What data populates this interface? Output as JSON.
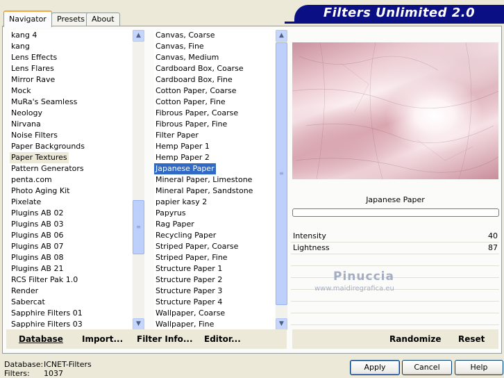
{
  "tabs": [
    "Navigator",
    "Presets",
    "About"
  ],
  "banner": "Filters Unlimited 2.0",
  "categories": {
    "items": [
      "kang 4",
      "kang",
      "Lens Effects",
      "Lens Flares",
      "Mirror Rave",
      "Mock",
      "MuRa's Seamless",
      "Neology",
      "Nirvana",
      "Noise Filters",
      "Paper Backgrounds",
      "Paper Textures",
      "Pattern Generators",
      "penta.com",
      "Photo Aging Kit",
      "Pixelate",
      "Plugins AB 02",
      "Plugins AB 03",
      "Plugins AB 06",
      "Plugins AB 07",
      "Plugins AB 08",
      "Plugins AB 21",
      "RCS Filter Pak 1.0",
      "Render",
      "Sabercat",
      "Sapphire Filters 01",
      "Sapphire Filters 03"
    ],
    "highlighted": "Paper Textures"
  },
  "filters": {
    "items": [
      "Canvas, Coarse",
      "Canvas, Fine",
      "Canvas, Medium",
      "Cardboard Box, Coarse",
      "Cardboard Box, Fine",
      "Cotton Paper, Coarse",
      "Cotton Paper, Fine",
      "Fibrous Paper, Coarse",
      "Fibrous Paper, Fine",
      "Filter Paper",
      "Hemp Paper 1",
      "Hemp Paper 2",
      "Japanese Paper",
      "Mineral Paper, Limestone",
      "Mineral Paper, Sandstone",
      "papier kasy 2",
      "Papyrus",
      "Rag Paper",
      "Recycling Paper",
      "Striped Paper, Coarse",
      "Striped Paper, Fine",
      "Structure Paper 1",
      "Structure Paper 2",
      "Structure Paper 3",
      "Structure Paper 4",
      "Wallpaper, Coarse",
      "Wallpaper, Fine"
    ],
    "selected": "Japanese Paper"
  },
  "preview": {
    "filter_name": "Japanese Paper",
    "watermark_name": "Pinuccia",
    "watermark_url": "www.maidiregrafica.eu"
  },
  "controls": [
    {
      "label": "Intensity",
      "value": "40"
    },
    {
      "label": "Lightness",
      "value": "87"
    }
  ],
  "bottom_buttons": {
    "database": "Database",
    "import": "Import...",
    "filter_info": "Filter Info...",
    "editor": "Editor...",
    "randomize": "Randomize",
    "reset": "Reset"
  },
  "status": {
    "database_label": "Database:",
    "database_value": "ICNET-Filters",
    "filters_label": "Filters:",
    "filters_value": "1037"
  },
  "dialog_buttons": {
    "apply": "Apply",
    "cancel": "Cancel",
    "help": "Help"
  }
}
